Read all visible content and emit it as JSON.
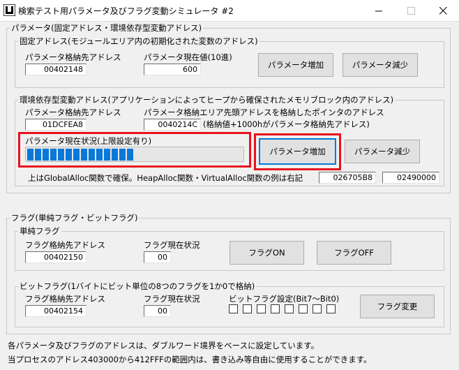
{
  "window": {
    "title": "検索テスト用パラメータ及びフラグ変動シミュレータ #2",
    "minimize_label": "minimize",
    "maximize_label": "maximize",
    "close_label": "close"
  },
  "param_section": {
    "title": "パラメータ(固定アドレス・環境依存型変動アドレス)",
    "fixed": {
      "title": "固定アドレス(モジュールエリア内の初期化された変数のアドレス)",
      "address_label": "パラメータ格納先アドレス",
      "address_value": "00402148",
      "value_label": "パラメータ現在値(10進)",
      "value": "600",
      "increase_label": "パラメータ増加",
      "decrease_label": "パラメータ減少"
    },
    "dynamic": {
      "title": "環境依存型変動アドレス(アプリケーションによってヒープから確保されたメモリブロック内のアドレス)",
      "address_label": "パラメータ格納先アドレス",
      "address_value": "01DCFEA8",
      "pointer_label": "パラメータ格納エリア先頭アドレスを格納したポインタのアドレス",
      "pointer_value": "0040214C",
      "pointer_note": "(格納値+1000hがパラメータ格納先アドレス)",
      "status_label": "パラメータ現在状況(上限設定有り)",
      "progress_fraction": 0.5,
      "increase_label": "パラメータ増加",
      "decrease_label": "パラメータ減少",
      "alloc_note": "上はGlobalAlloc関数で確保。HeapAlloc関数・VirtualAlloc関数の例は右記",
      "heap_value": "026705B8",
      "virtual_value": "02490000"
    }
  },
  "flag_section": {
    "title": "フラグ(単純フラグ・ビットフラグ)",
    "simple": {
      "title": "単純フラグ",
      "address_label": "フラグ格納先アドレス",
      "address_value": "00402150",
      "status_label": "フラグ現在状況",
      "status_value": "00",
      "on_label": "フラグON",
      "off_label": "フラグOFF"
    },
    "bit": {
      "title": "ビットフラグ(1バイトにビット単位の8つのフラグを1か0で格納)",
      "address_label": "フラグ格納先アドレス",
      "address_value": "00402154",
      "status_label": "フラグ現在状況",
      "status_value": "00",
      "bits_label": "ビットフラグ設定(Bit7〜Bit0)",
      "bits": [
        false,
        false,
        false,
        false,
        false,
        false,
        false,
        false
      ],
      "change_label": "フラグ変更"
    }
  },
  "footer": {
    "line1": "各パラメータ及びフラグのアドレスは、ダブルワード境界をベースに設定しています。",
    "line2": "当プロセスのアドレス403000から412FFFの範囲内は、書き込み等自由に使用することができます。"
  },
  "colors": {
    "highlight": "#e8131d",
    "progress": "#0a78d7",
    "focus": "#0078d7"
  }
}
